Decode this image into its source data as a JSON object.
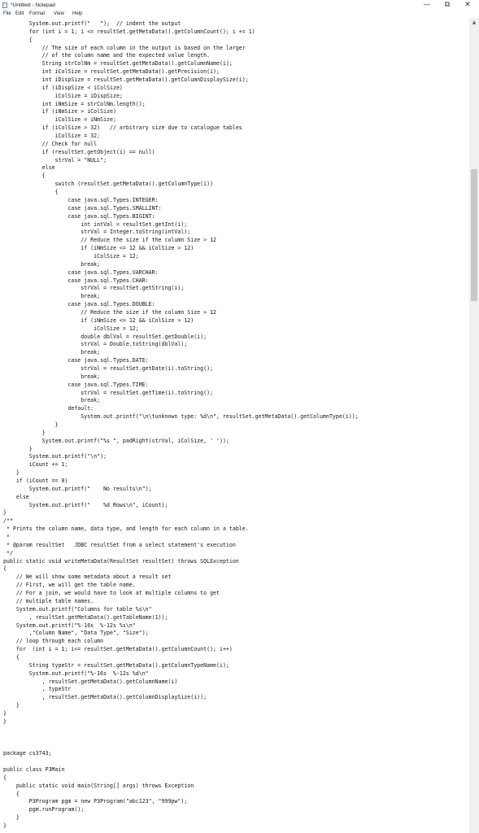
{
  "window": {
    "title": "*Untitled - Notepad",
    "controls": {
      "minimize": "—",
      "maximize": "⧉",
      "close": "✕"
    }
  },
  "menu": [
    "File",
    "Edit",
    "Format",
    "View",
    "Help"
  ],
  "editor": {
    "lines": [
      "        System.out.printf(\"   \");  // indent the output",
      "        for (int i = 1; i <= resultSet.getMetaData().getColumnCount(); i += 1)",
      "        {",
      "            // The size of each column in the output is based on the larger",
      "            // of the column name and the expected value length.",
      "            String strColNm = resultSet.getMetaData().getColumnName(i);",
      "            int iColSize = resultSet.getMetaData().getPrecision(i);",
      "            int iDispSize = resultSet.getMetaData().getColumnDisplaySize(i);",
      "            if (iDispSize < iColSize)",
      "                iColSize = iDispSize;",
      "            int iNmSize = strColNm.length();",
      "            if (iNmSize > iColSize)",
      "                iColSize = iNmSize;",
      "            if (iColSize > 32)   // arbitrary size due to catalogue tables",
      "                iColSize = 32;",
      "            // Check for null",
      "            if (resultSet.getObject(i) == null)",
      "                strVal = \"NULL\";",
      "            else",
      "            {",
      "                switch (resultSet.getMetaData().getColumnType(i))",
      "                {",
      "                    case java.sql.Types.INTEGER:",
      "                    case java.sql.Types.SMALLINT:",
      "                    case java.sql.Types.BIGINT:",
      "                        int intVal = resultSet.getInt(i);",
      "                        strVal = Integer.toString(intVal);",
      "                        // Reduce the size if the column Size > 12",
      "                        if (iNmSize <= 12 && iColSize > 12)",
      "                            iColSize = 12;",
      "                        break;",
      "                    case java.sql.Types.VARCHAR:",
      "                    case java.sql.Types.CHAR:",
      "                        strVal = resultSet.getString(i);",
      "                        break;",
      "                    case java.sql.Types.DOUBLE:",
      "                        // Reduce the size if the column Size > 12",
      "                        if (iNmSize <= 12 && iColSize > 12)",
      "                            iColSize = 12;",
      "                        double dblVal = resultSet.getDouble(i);",
      "                        strVal = Double.toString(dblVal);",
      "                        break;",
      "                    case java.sql.Types.DATE:",
      "                        strVal = resultSet.getDate(i).toString();",
      "                        break;",
      "                    case java.sql.Types.TIME:",
      "                        strVal = resultSet.getTime(i).toString();",
      "                        break;",
      "                    default:",
      "                        System.out.printf(\"\\n\\tunknown type: %d\\n\", resultSet.getMetaData().getColumnType(i));",
      "                }",
      "            }",
      "            System.out.printf(\"%s \", padRight(strVal, iColSize, ' '));",
      "        }",
      "        System.out.printf(\"\\n\");",
      "        iCount += 1;",
      "    }",
      "    if (iCount == 0)",
      "        System.out.printf(\"    No results\\n\");",
      "    else",
      "        System.out.printf(\"    %d Rows\\n\", iCount);",
      "}",
      "/**",
      " * Prints the column name, data type, and length for each column in a table.",
      " *",
      " * @param resultSet   JDBC resultSet from a select statement's execution",
      " */",
      "public static void writeMetaData(ResultSet resultSet) throws SQLException",
      "{",
      "    // We will show some metadata about a result set",
      "    // First, we will get the table name.",
      "    // For a join, we would have to look at multiple columns to get",
      "    // multiple table names.",
      "    System.out.printf(\"Columns for table %s\\n\"",
      "        , resultSet.getMetaData().getTableName(1));",
      "    System.out.printf(\"%-16s  %-12s %s\\n\"",
      "        ,\"Column Name\", \"Data Type\", \"Size\");",
      "    // loop through each column",
      "    for  (int i = 1; i<= resultSet.getMetaData().getColumnCount(); i++)",
      "    {",
      "        String typeStr = resultSet.getMetaData().getColumnTypeName(i);",
      "        System.out.printf(\"%-16s  %-12s %d\\n\"",
      "            , resultSet.getMetaData().getColumnName(i)",
      "            , typeStr",
      "            , resultSet.getMetaData().getColumnDisplaySize(i));",
      "    }",
      "}",
      "}",
      "",
      "",
      "",
      "package cs3743;",
      "",
      "public class P3Main",
      "{",
      "    public static void main(String[] args) throws Exception",
      "    {",
      "        P3Program pgm = new P3Program(\"abc123\", \"999pw\");",
      "        pgm.runProgram();",
      "    }",
      "}"
    ]
  },
  "scrollbar": {
    "up_arrow": "▲"
  }
}
